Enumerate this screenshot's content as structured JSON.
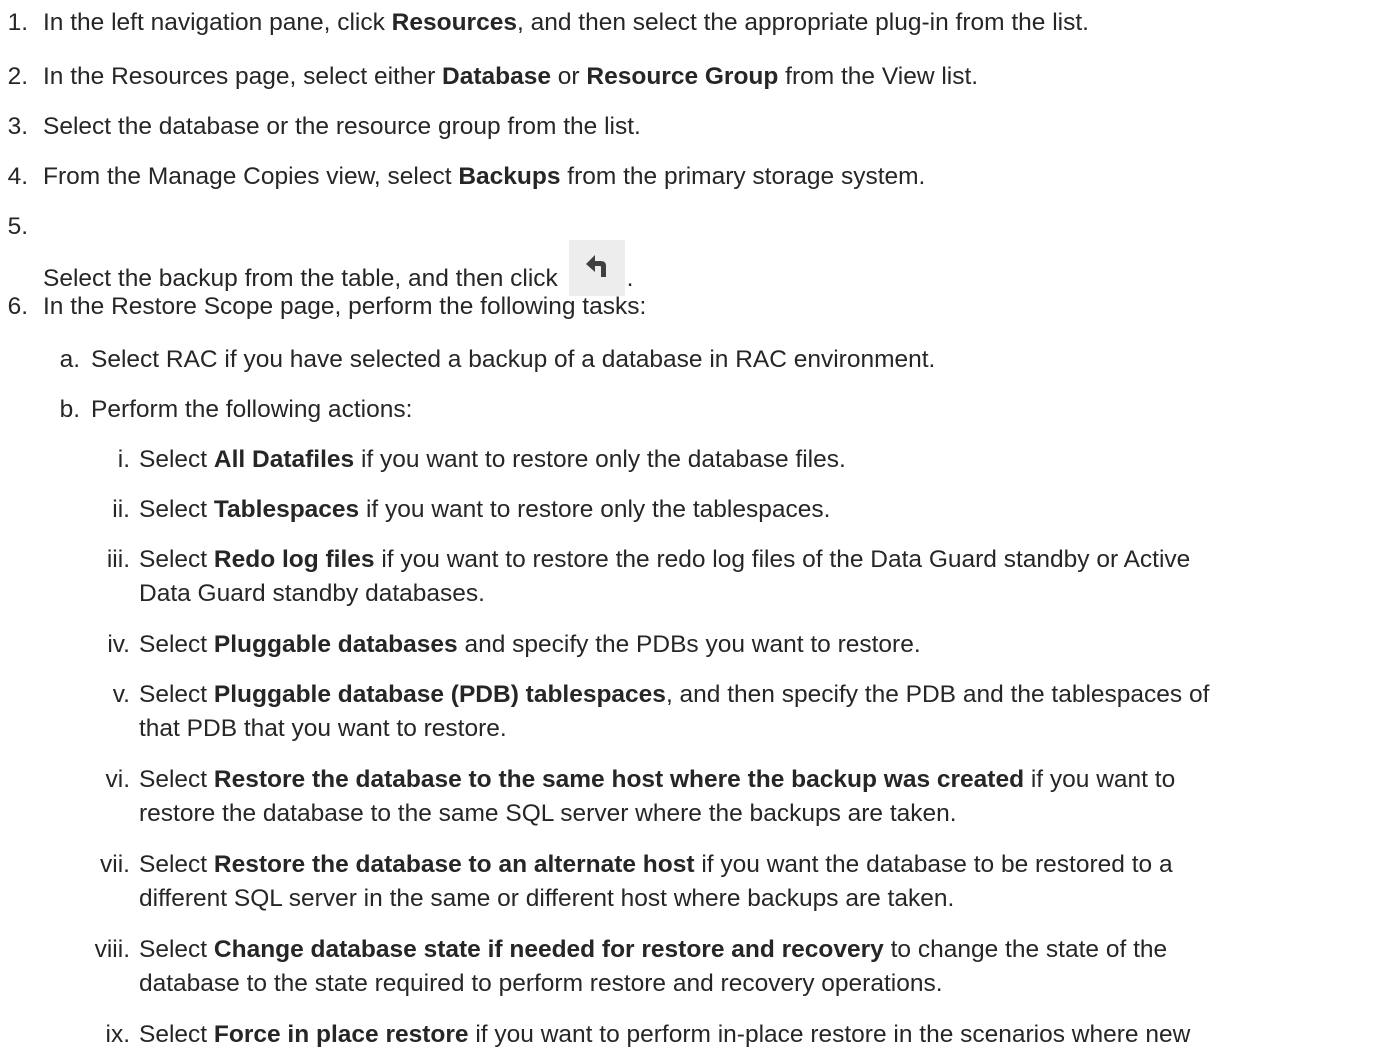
{
  "steps": [
    {
      "num": "1.",
      "parts": [
        {
          "t": "In the left navigation pane, click "
        },
        {
          "t": "Resources",
          "b": true
        },
        {
          "t": ", and then select the appropriate plug-in from the list."
        }
      ]
    },
    {
      "num": "2.",
      "parts": [
        {
          "t": "In the Resources page, select either "
        },
        {
          "t": "Database",
          "b": true
        },
        {
          "t": " or "
        },
        {
          "t": "Resource Group",
          "b": true
        },
        {
          "t": " from the View list."
        }
      ]
    },
    {
      "num": "3.",
      "parts": [
        {
          "t": "Select the database or the resource group from the list."
        }
      ]
    },
    {
      "num": "4.",
      "parts": [
        {
          "t": "From the Manage Copies view, select "
        },
        {
          "t": "Backups",
          "b": true
        },
        {
          "t": " from the primary storage system."
        }
      ]
    },
    {
      "num": "5.",
      "parts": [
        {
          "t": "Select the backup from the table, and then click "
        },
        {
          "icon": "restore-arrow-icon"
        },
        {
          "t": "."
        }
      ]
    },
    {
      "num": "6.",
      "parts": [
        {
          "t": "In the Restore Scope page, perform the following tasks:"
        }
      ]
    }
  ],
  "substeps": [
    {
      "num": "a.",
      "parts": [
        {
          "t": "Select RAC if you have selected a backup of a database in RAC environment."
        }
      ]
    },
    {
      "num": "b.",
      "parts": [
        {
          "t": "Perform the following actions:"
        }
      ]
    }
  ],
  "actions": [
    {
      "num": "i.",
      "lines": [
        [
          {
            "t": "Select "
          },
          {
            "t": "All Datafiles",
            "b": true
          },
          {
            "t": " if you want to restore only the database files."
          }
        ]
      ]
    },
    {
      "num": "ii.",
      "lines": [
        [
          {
            "t": "Select "
          },
          {
            "t": "Tablespaces",
            "b": true
          },
          {
            "t": " if you want to restore only the tablespaces."
          }
        ]
      ]
    },
    {
      "num": "iii.",
      "lines": [
        [
          {
            "t": "Select "
          },
          {
            "t": "Redo log files",
            "b": true
          },
          {
            "t": " if you want to restore the redo log files of the Data Guard standby or Active"
          }
        ],
        [
          {
            "t": "Data Guard standby databases."
          }
        ]
      ]
    },
    {
      "num": "iv.",
      "lines": [
        [
          {
            "t": "Select "
          },
          {
            "t": "Pluggable databases",
            "b": true
          },
          {
            "t": " and specify the PDBs you want to restore."
          }
        ]
      ]
    },
    {
      "num": "v.",
      "lines": [
        [
          {
            "t": "Select "
          },
          {
            "t": "Pluggable database (PDB) tablespaces",
            "b": true
          },
          {
            "t": ", and then specify the PDB and the tablespaces of"
          }
        ],
        [
          {
            "t": "that PDB that you want to restore."
          }
        ]
      ]
    },
    {
      "num": "vi.",
      "lines": [
        [
          {
            "t": "Select "
          },
          {
            "t": "Restore the database to the same host where the backup was created",
            "b": true
          },
          {
            "t": " if you want to"
          }
        ],
        [
          {
            "t": "restore the database to the same SQL server where the backups are taken."
          }
        ]
      ]
    },
    {
      "num": "vii.",
      "lines": [
        [
          {
            "t": "Select "
          },
          {
            "t": "Restore the database to an alternate host",
            "b": true
          },
          {
            "t": " if you want the database to be restored to a"
          }
        ],
        [
          {
            "t": "different SQL server in the same or different host where backups are taken."
          }
        ]
      ]
    },
    {
      "num": "viii.",
      "lines": [
        [
          {
            "t": "Select "
          },
          {
            "t": "Change database state if needed for restore and recovery",
            "b": true
          },
          {
            "t": " to change the state of the"
          }
        ],
        [
          {
            "t": "database to the state required to perform restore and recovery operations."
          }
        ]
      ]
    },
    {
      "num": "ix.",
      "lines": [
        [
          {
            "t": "Select "
          },
          {
            "t": "Force in place restore",
            "b": true
          },
          {
            "t": " if you want to perform in-place restore in the scenarios where new"
          }
        ]
      ]
    }
  ]
}
